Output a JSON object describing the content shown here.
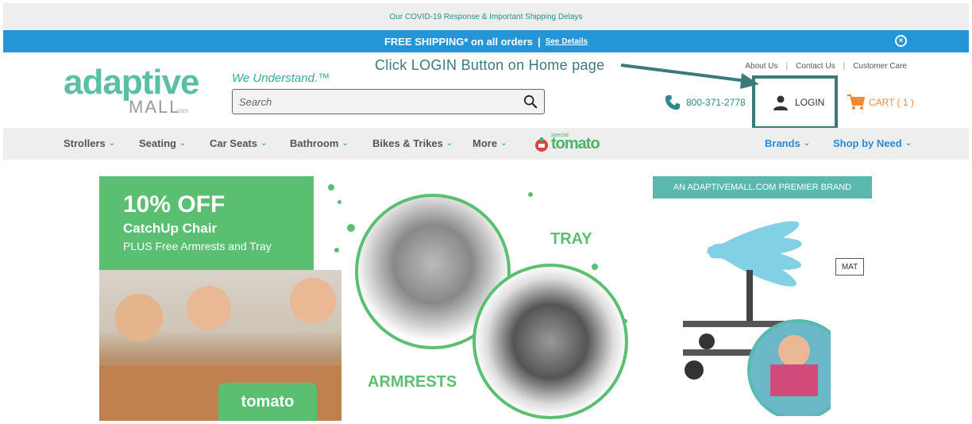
{
  "notice": {
    "text": "Our COVID-19 Response & Important Shipping Delays"
  },
  "shipping_bar": {
    "text": "FREE SHIPPING* on all orders",
    "separator": "|",
    "link": "See Details"
  },
  "logo": {
    "word": "adaptive",
    "mall": "MALL",
    "dotcom": ".com"
  },
  "tagline": "We Understand.™",
  "search": {
    "placeholder": "Search"
  },
  "annotation": "Click LOGIN Button on Home page",
  "top_links": [
    "About Us",
    "Contact Us",
    "Customer Care"
  ],
  "top_links_sep": "|",
  "phone": "800-371-2778",
  "login_label": "LOGIN",
  "cart_label": "CART ( 1 )",
  "nav": {
    "items": [
      "Strollers",
      "Seating",
      "Car Seats",
      "Bathroom",
      "Bikes & Trikes",
      "More"
    ],
    "tomato": "tomato",
    "tomato_small": "special",
    "right": [
      "Brands",
      "Shop by Need"
    ]
  },
  "promo": {
    "headline": "10% OFF",
    "product": "CatchUp Chair",
    "subline": "PLUS Free Armrests and Tray",
    "tray_label": "TRAY",
    "armrests_label": "ARMRESTS",
    "badge": "tomato"
  },
  "brand_panel": {
    "header": "AN ADAPTIVEMALL.COM PREMIER BRAND",
    "tag": "MAT"
  },
  "colors": {
    "teal": "#5bbfa6",
    "blue_bar": "#2496d8",
    "green": "#5bbf72",
    "cart": "#f08a3a",
    "login_border": "#3b7a7a"
  }
}
